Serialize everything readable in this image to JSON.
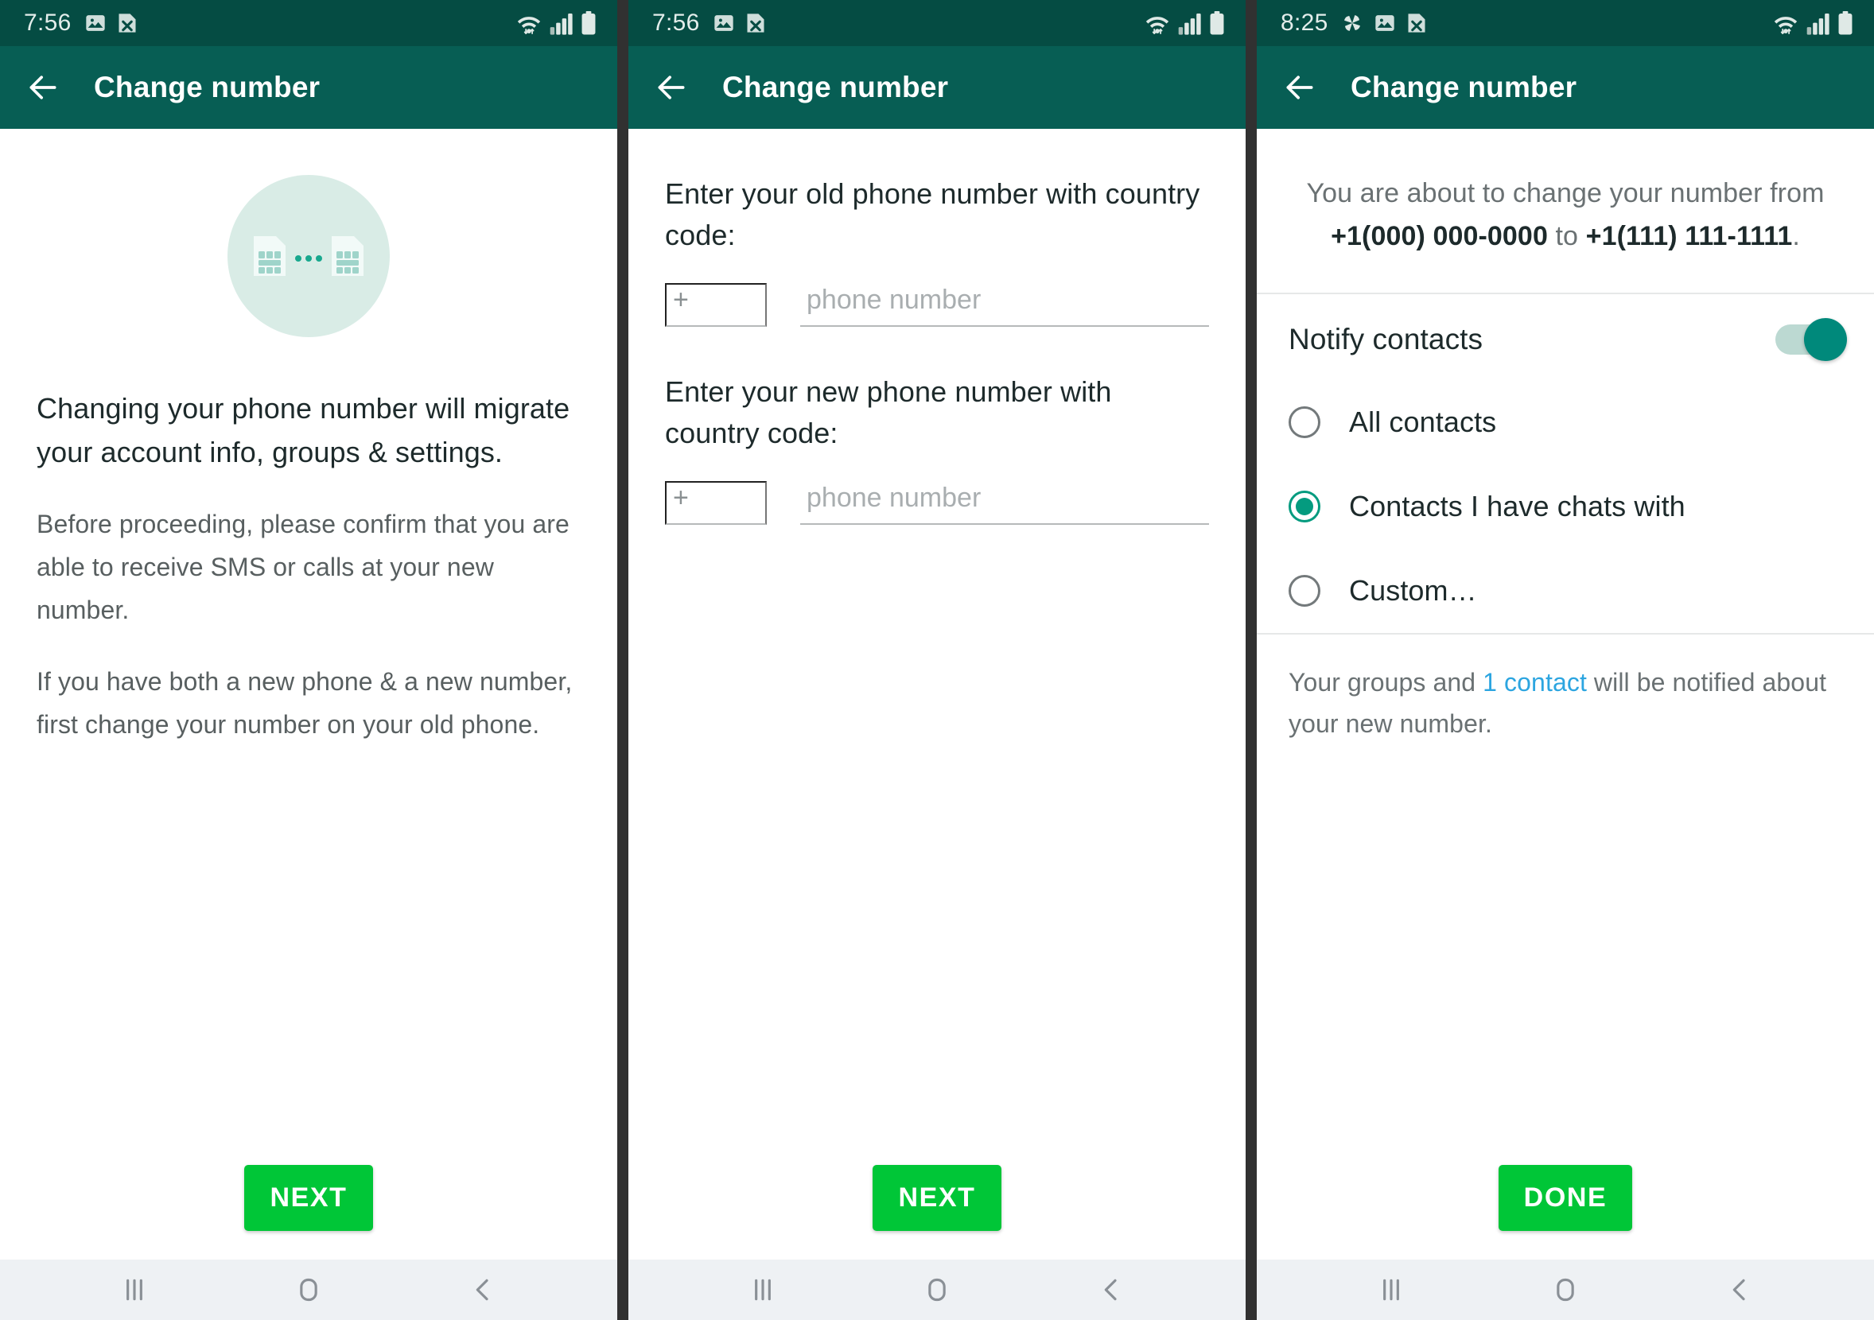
{
  "app": {
    "title": "Change number",
    "accent_green": "#00c637",
    "appbar_green": "#075e54",
    "statusbar_green": "#054c43",
    "toggle_on_color": "#00897b",
    "radio_selected_color": "#049b7f",
    "link_color": "#2ca5e0"
  },
  "panels": [
    {
      "status": {
        "time": "7:56",
        "icons": [
          "image-icon",
          "file-x-icon"
        ],
        "right_icons": [
          "wifi-icon",
          "signal-icon",
          "battery-icon"
        ]
      },
      "appbar": {
        "title": "Change number",
        "back_icon": "arrow-left-icon"
      },
      "hero_icon": "dual-sim-transfer-icon",
      "title": "Changing your phone number will migrate your account info, groups & settings.",
      "paragraph_1": "Before proceeding, please confirm that you are able to receive SMS or calls at your new number.",
      "paragraph_2": "If you have both a new phone & a new number, first change your number on your old phone.",
      "cta_label": "NEXT"
    },
    {
      "status": {
        "time": "7:56",
        "icons": [
          "image-icon",
          "file-x-icon"
        ],
        "right_icons": [
          "wifi-icon",
          "signal-icon",
          "battery-icon"
        ]
      },
      "appbar": {
        "title": "Change number",
        "back_icon": "arrow-left-icon"
      },
      "old_label": "Enter your old phone number with country code:",
      "new_label": "Enter your new phone number with country code:",
      "country_code_value": "+",
      "phone_placeholder": "phone number",
      "cta_label": "NEXT"
    },
    {
      "status": {
        "time": "8:25",
        "icons": [
          "pinwheel-icon",
          "image-icon",
          "file-x-icon"
        ],
        "right_icons": [
          "wifi-icon",
          "signal-icon",
          "battery-icon"
        ]
      },
      "appbar": {
        "title": "Change number",
        "back_icon": "arrow-left-icon"
      },
      "summary": {
        "prefix": "You are about to change your number from ",
        "old_number": "+1(000) 000-0000",
        "middle": " to ",
        "new_number": "+1(111) 111-1111",
        "suffix": "."
      },
      "notify_label": "Notify contacts",
      "notify_enabled": true,
      "options": [
        {
          "label": "All contacts",
          "selected": false
        },
        {
          "label": "Contacts I have chats with",
          "selected": true
        },
        {
          "label": "Custom…",
          "selected": false
        }
      ],
      "footer": {
        "prefix": "Your groups and ",
        "link": "1 contact",
        "suffix": " will be notified about your new number."
      },
      "cta_label": "DONE"
    }
  ],
  "navbar": {
    "recents": "recents-icon",
    "home": "home-icon",
    "back": "back-icon"
  }
}
